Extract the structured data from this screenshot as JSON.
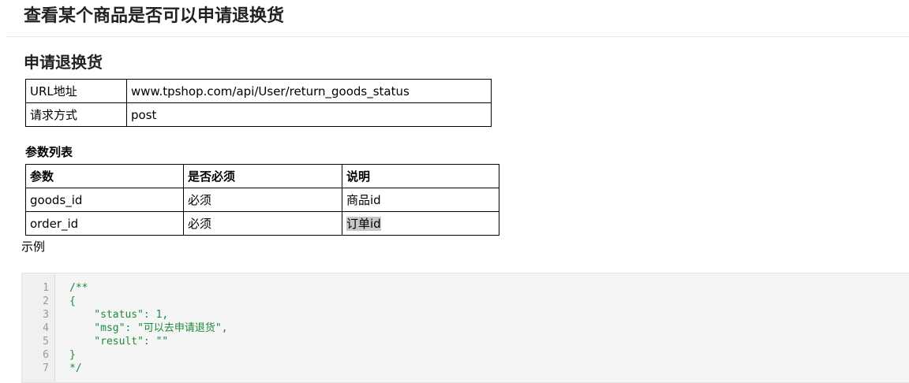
{
  "page": {
    "title": "查看某个商品是否可以申请退换货"
  },
  "section": {
    "title": "申请退换货"
  },
  "info_table": {
    "rows": [
      {
        "key": "URL地址",
        "value": "www.tpshop.com/api/User/return_goods_status"
      },
      {
        "key": "请求方式",
        "value": "post"
      }
    ]
  },
  "params": {
    "label": "参数列表",
    "headers": [
      "参数",
      "是否必须",
      "说明"
    ],
    "rows": [
      [
        "goods_id",
        "必须",
        "商品id"
      ],
      [
        "order_id",
        "必须",
        "订单id"
      ]
    ]
  },
  "example": {
    "label": "示例",
    "line_numbers": [
      "1",
      "2",
      "3",
      "4",
      "5",
      "6",
      "7"
    ],
    "lines": [
      "/**",
      "{",
      "    \"status\": 1,",
      "    \"msg\": \"可以去申请退货\",",
      "    \"result\": \"\"",
      "}",
      "*/"
    ]
  },
  "colors": {
    "code_text": "#1c8a3b",
    "code_background": "#f5f5f5",
    "highlight": "#c8c8c8"
  }
}
